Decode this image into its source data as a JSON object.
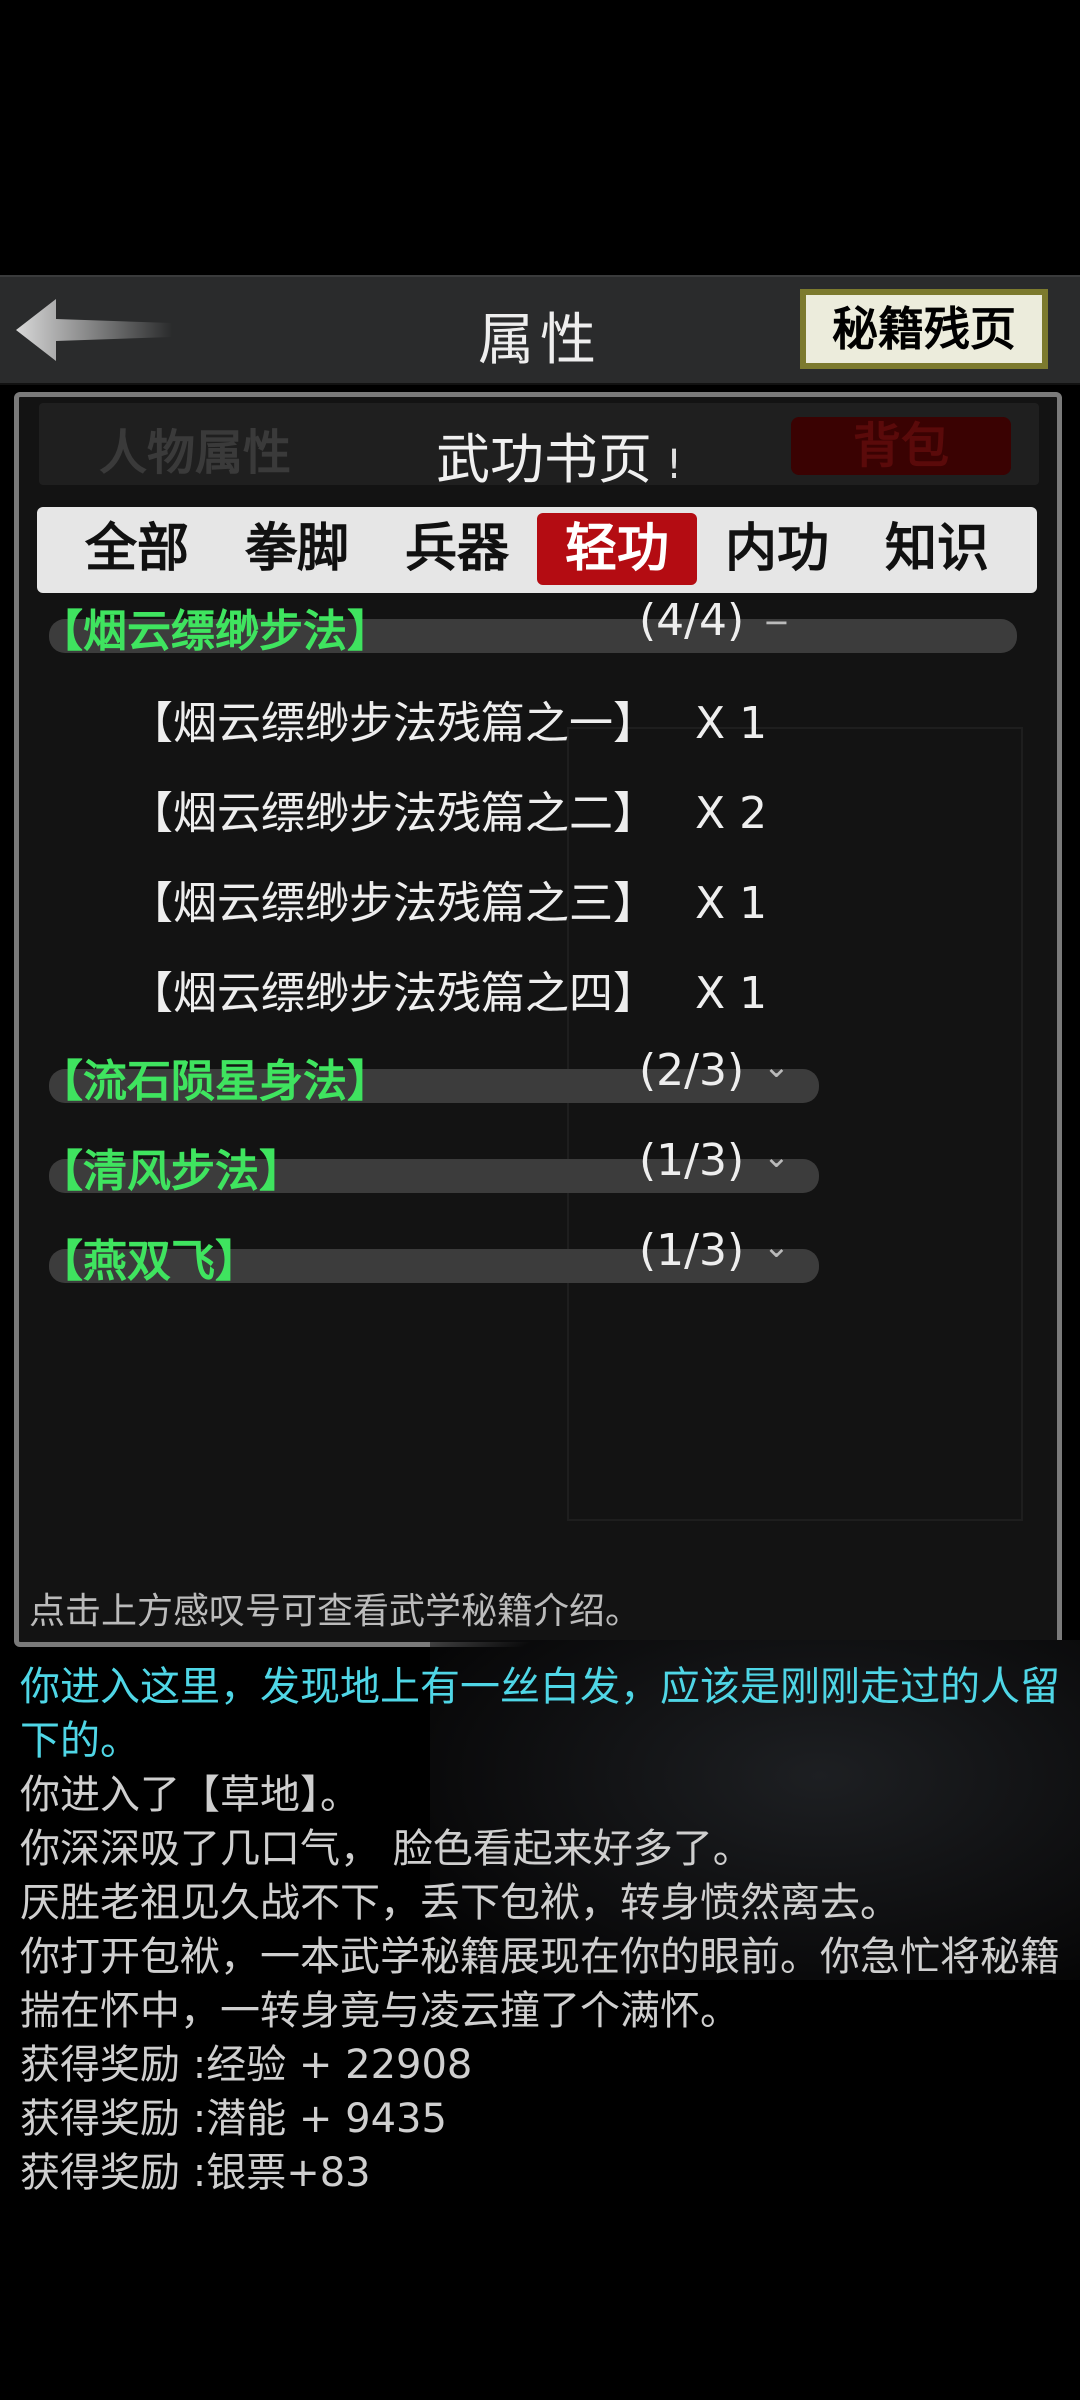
{
  "header": {
    "title": "属性",
    "right_button": "秘籍残页"
  },
  "panel": {
    "behind_tab_left": "人物属性",
    "behind_tab_right": "背包",
    "title": "武功书页",
    "info_mark": "!",
    "tabs": [
      "全部",
      "拳脚",
      "兵器",
      "轻功",
      "内功",
      "知识"
    ],
    "active_tab": "轻功",
    "categories": [
      {
        "name": "【烟云缥缈步法】",
        "count": "(4/4)",
        "toggle": "−",
        "items": [
          {
            "name": "【烟云缥缈步法残篇之一】",
            "qty": "X 1"
          },
          {
            "name": "【烟云缥缈步法残篇之二】",
            "qty": "X 2"
          },
          {
            "name": "【烟云缥缈步法残篇之三】",
            "qty": "X 1"
          },
          {
            "name": "【烟云缥缈步法残篇之四】",
            "qty": "X 1"
          }
        ]
      },
      {
        "name": "【流石陨星身法】",
        "count": "(2/3)",
        "toggle": "⌄",
        "items": []
      },
      {
        "name": "【清风步法】",
        "count": "(1/3)",
        "toggle": "⌄",
        "items": []
      },
      {
        "name": "【燕双飞】",
        "count": "(1/3)",
        "toggle": "⌄",
        "items": []
      }
    ],
    "hint": "点击上方感叹号可查看武学秘籍介绍。"
  },
  "log": [
    {
      "text": "你进入这里，发现地上有一丝白发，应该是刚刚走过的人留下的。",
      "color": "#4fd6e6"
    },
    {
      "text": "你进入了【草地】。",
      "color": "#cfcfcf"
    },
    {
      "text": "你深深吸了几口气， 脸色看起来好多了。",
      "color": "#cfcfcf"
    },
    {
      "text": "厌胜老祖见久战不下，丢下包袱，转身愤然离去。",
      "color": "#cfcfcf"
    },
    {
      "text": "你打开包袱，一本武学秘籍展现在你的眼前。你急忙将秘籍揣在怀中，一转身竟与凌云撞了个满怀。",
      "color": "#cfcfcf"
    },
    {
      "text": "获得奖励 :经验 + 22908",
      "color": "#cfcfcf"
    },
    {
      "text": "获得奖励 :潜能 + 9435",
      "color": "#cfcfcf"
    },
    {
      "text": "获得奖励 :银票+83",
      "color": "#cfcfcf"
    }
  ],
  "colors": {
    "active_tab": "#b40c12",
    "category_name": "#3fe45f",
    "log_cyan": "#4fd6e6"
  }
}
